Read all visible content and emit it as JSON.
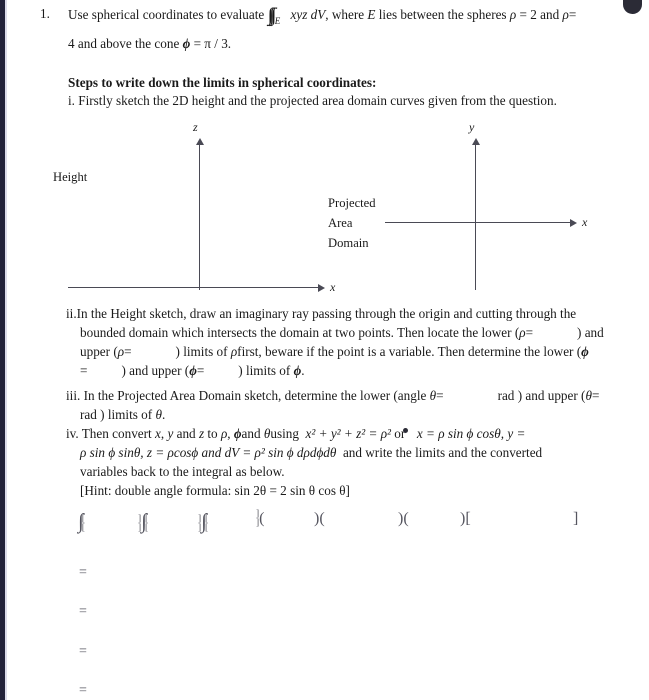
{
  "document": {
    "question_number": "1.",
    "question_text_a": "Use spherical coordinates to evaluate",
    "integral_symbol": "∭",
    "integral_subscript": "E",
    "integrand": "xyz dV",
    "question_text_b": ", where",
    "region_symbol": "E",
    "question_text_c": "lies between the spheres",
    "rho_symbol": "ρ",
    "sphere_eq_1": "= 2 and",
    "sphere_eq_2": "=",
    "question_line2": "4 and above the cone",
    "phi_symbol": "ϕ",
    "cone_eq": "= π / 3."
  },
  "steps": {
    "heading": "Steps to write down the limits in spherical coordinates:",
    "step_i": "i. Firstly sketch the 2D height and the projected area domain curves given from the question.",
    "step_ii": {
      "line1": "ii.In the Height sketch, draw an imaginary ray passing through the origin and cutting through the",
      "line2_a": "bounded domain which intersects the domain at two points. Then locate the lower (",
      "line2_rho": "ρ",
      "line2_b": "=",
      "line2_c": ") and",
      "line3_a": "upper (",
      "line3_rho": "ρ",
      "line3_b": "=",
      "line3_c": ") limits of",
      "line3_rho2": "ρ",
      "line3_d": "first, beware if the point is a variable. Then determine the lower (",
      "line3_phi": "ϕ",
      "line4_a": "=",
      "line4_b": ") and upper (",
      "line4_phi": "ϕ",
      "line4_c": "=",
      "line4_d": ") limits of",
      "line4_phi2": "ϕ",
      "line4_e": "."
    },
    "step_iii": {
      "line1_a": "iii. In the Projected Area Domain sketch, determine the lower (angle",
      "line1_theta": "θ",
      "line1_b": "=",
      "line1_rad": "rad ) and upper (",
      "line1_theta2": "θ",
      "line1_c": "=",
      "line2": "rad ) limits of",
      "line2_theta": "θ",
      "line2_b": "."
    },
    "step_iv": {
      "line1_a": "iv. Then convert",
      "line1_x": "x",
      "line1_b": ",",
      "line1_y": "y",
      "line1_c": "and",
      "line1_z": "z",
      "line1_d": "to",
      "line1_rho": "ρ",
      "line1_e": ",",
      "line1_phi": "ϕ",
      "line1_f": "and",
      "line1_theta": "θ",
      "line1_g": "using",
      "line1_eq": "x² + y² + z² = ρ²",
      "line1_or": "or",
      "line1_eq2": "x = ρ sin ϕ cosθ,  y =",
      "line2": "ρ sin ϕ sinθ,  z = ρcosϕ and  dV = ρ² sin ϕ dρdϕdθ",
      "line2_b": "and write the limits and the converted",
      "line3": "variables back to the integral as below.",
      "line4": "[Hint:  double angle formula:  sin 2θ = 2 sin θ cos θ]"
    }
  },
  "sketches": {
    "height": {
      "caption": "Height",
      "y_axis_label": "z",
      "x_axis_label": "x"
    },
    "projected": {
      "caption_line1": "Projected",
      "caption_line2": "Area",
      "caption_line3": "Domain",
      "y_axis_label": "y",
      "x_axis_label": "x"
    }
  },
  "answer_row": {
    "units": [
      {
        "pre": "",
        "glyph": "∫",
        "upper": "[",
        "lower": "["
      },
      {
        "pre": "]\n]",
        "glyph": "∫",
        "upper": "[",
        "lower": "["
      },
      {
        "pre": "]\n]",
        "glyph": "∫",
        "upper": "[",
        "lower": "["
      },
      {
        "pre": "]\n]",
        "glyph": "",
        "upper": "",
        "lower": ""
      }
    ],
    "int1_pre_upper": "]",
    "int1_pre_lower": "]",
    "paren_open": "(",
    "paren_close": ")",
    "bracket_open": "[",
    "bracket_close": "]",
    "group1": "(",
    "group2": ")(",
    "group3": ")(",
    "group4": ")[",
    "group5": "]"
  },
  "equals_lines": [
    "=",
    "=",
    "=",
    "="
  ],
  "colors": {
    "page_background": "#ffffff",
    "text": "#1a1a1a",
    "axis": "#4a4a55",
    "faded_math": "#55555f",
    "edge_strip": "#22223a"
  }
}
